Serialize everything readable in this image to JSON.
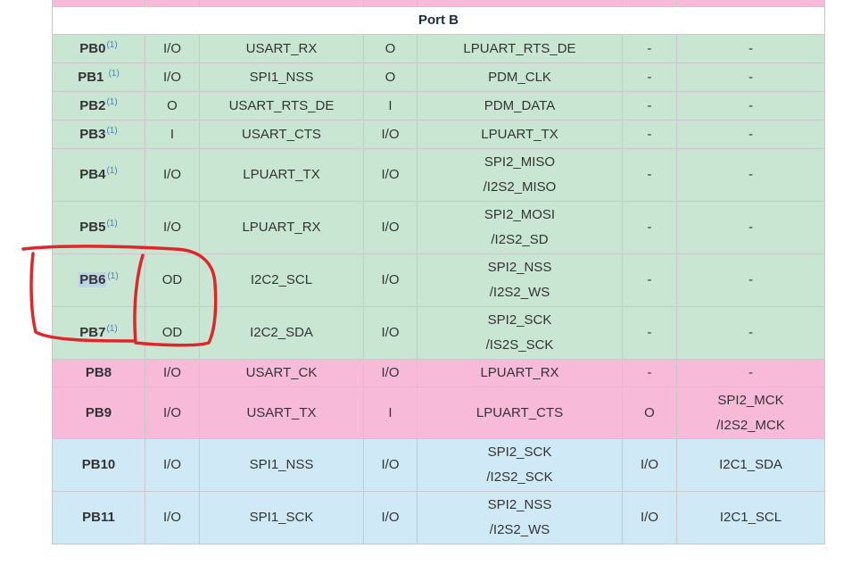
{
  "port_title": "Port B",
  "annotation_color": "#e0262a",
  "rows": [
    {
      "pin": "PB0",
      "note": "(1)",
      "c1": "I/O",
      "c2": "USART_RX",
      "c3": "O",
      "c4a": "LPUART_RTS_DE",
      "c4b": "",
      "c5": "-",
      "c6a": "-",
      "c6b": ""
    },
    {
      "pin": "PB1",
      "note": "(1)",
      "c1": "I/O",
      "c2": "SPI1_NSS",
      "c3": "O",
      "c4a": "PDM_CLK",
      "c4b": "",
      "c5": "-",
      "c6a": "-",
      "c6b": ""
    },
    {
      "pin": "PB2",
      "note": "(1)",
      "c1": "O",
      "c2": "USART_RTS_DE",
      "c3": "I",
      "c4a": "PDM_DATA",
      "c4b": "",
      "c5": "-",
      "c6a": "-",
      "c6b": ""
    },
    {
      "pin": "PB3",
      "note": "(1)",
      "c1": "I",
      "c2": "USART_CTS",
      "c3": "I/O",
      "c4a": "LPUART_TX",
      "c4b": "",
      "c5": "-",
      "c6a": "-",
      "c6b": ""
    },
    {
      "pin": "PB4",
      "note": "(1)",
      "c1": "I/O",
      "c2": "LPUART_TX",
      "c3": "I/O",
      "c4a": "SPI2_MISO",
      "c4b": "/I2S2_MISO",
      "c5": "-",
      "c6a": "-",
      "c6b": ""
    },
    {
      "pin": "PB5",
      "note": "(1)",
      "c1": "I/O",
      "c2": "LPUART_RX",
      "c3": "I/O",
      "c4a": "SPI2_MOSI",
      "c4b": "/I2S2_SD",
      "c5": "-",
      "c6a": "-",
      "c6b": ""
    },
    {
      "pin": "PB6",
      "note": "(1)",
      "c1": "OD",
      "c2": "I2C2_SCL",
      "c3": "I/O",
      "c4a": "SPI2_NSS",
      "c4b": "/I2S2_WS",
      "c5": "-",
      "c6a": "-",
      "c6b": ""
    },
    {
      "pin": "PB7",
      "note": "(1)",
      "c1": "OD",
      "c2": "I2C2_SDA",
      "c3": "I/O",
      "c4a": "SPI2_SCK",
      "c4b": "/IS2S_SCK",
      "c5": "-",
      "c6a": "-",
      "c6b": ""
    },
    {
      "pin": "PB8",
      "note": "",
      "c1": "I/O",
      "c2": "USART_CK",
      "c3": "I/O",
      "c4a": "LPUART_RX",
      "c4b": "",
      "c5": "-",
      "c6a": "-",
      "c6b": ""
    },
    {
      "pin": "PB9",
      "note": "",
      "c1": "I/O",
      "c2": "USART_TX",
      "c3": "I",
      "c4a": "LPUART_CTS",
      "c4b": "",
      "c5": "O",
      "c6a": "SPI2_MCK",
      "c6b": "/I2S2_MCK"
    },
    {
      "pin": "PB10",
      "note": "",
      "c1": "I/O",
      "c2": "SPI1_NSS",
      "c3": "I/O",
      "c4a": "SPI2_SCK",
      "c4b": "/I2S2_SCK",
      "c5": "I/O",
      "c6a": "I2C1_SDA",
      "c6b": ""
    },
    {
      "pin": "PB11",
      "note": "",
      "c1": "I/O",
      "c2": "SPI1_SCK",
      "c3": "I/O",
      "c4a": "SPI2_NSS",
      "c4b": "/I2S2_WS",
      "c5": "I/O",
      "c6a": "I2C1_SCL",
      "c6b": ""
    }
  ]
}
